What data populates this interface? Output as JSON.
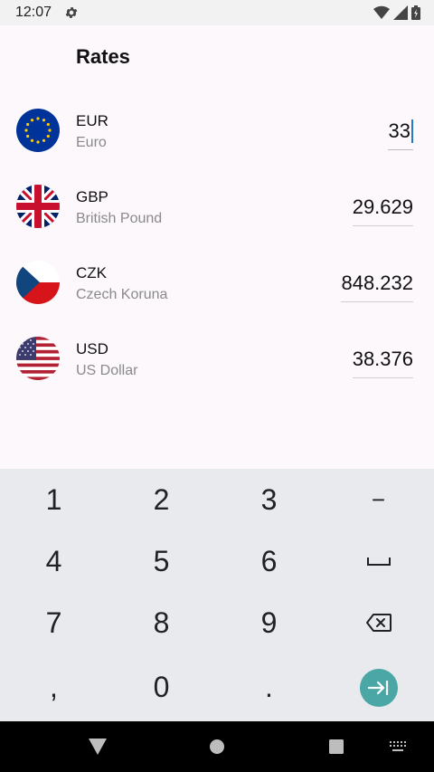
{
  "status_bar": {
    "time": "12:07",
    "icons": [
      "settings-gear-icon",
      "wifi-icon",
      "signal-icon",
      "battery-icon"
    ]
  },
  "app_bar": {
    "title": "Rates"
  },
  "currencies": [
    {
      "code": "EUR",
      "name": "Euro",
      "amount": "33",
      "flag": "eu-flag-icon",
      "active": true
    },
    {
      "code": "GBP",
      "name": "British Pound",
      "amount": "29.629",
      "flag": "uk-flag-icon",
      "active": false
    },
    {
      "code": "CZK",
      "name": "Czech Koruna",
      "amount": "848.232",
      "flag": "czech-flag-icon",
      "active": false
    },
    {
      "code": "USD",
      "name": "US Dollar",
      "amount": "38.376",
      "flag": "us-flag-icon",
      "active": false
    }
  ],
  "keyboard": {
    "keys": [
      [
        "1",
        "2",
        "3",
        "−"
      ],
      [
        "4",
        "5",
        "6",
        "space"
      ],
      [
        "7",
        "8",
        "9",
        "backspace"
      ],
      [
        ",",
        "0",
        ".",
        "next"
      ]
    ]
  },
  "nav_bar": {
    "buttons": [
      "back-icon",
      "home-icon",
      "recents-icon",
      "keyboard-switch-icon"
    ]
  },
  "colors": {
    "accent": "#4ba6a6",
    "cursor": "#1e7cc8",
    "keyboard_bg": "#e8eaed",
    "background": "#fcf8fc"
  }
}
